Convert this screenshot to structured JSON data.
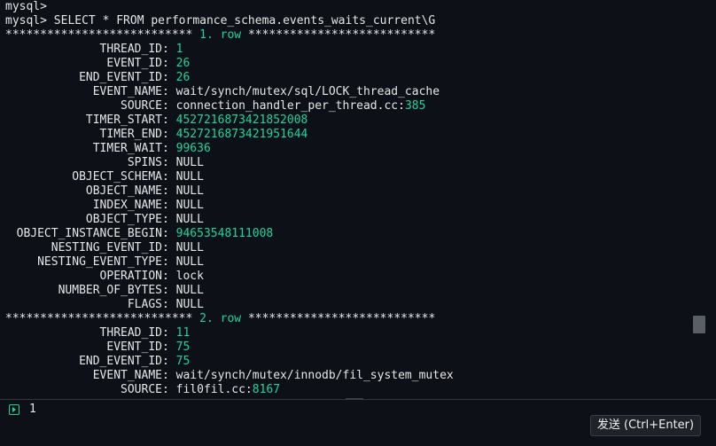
{
  "terminal": {
    "lines": [
      {
        "type": "text",
        "text": "mysql>"
      },
      {
        "type": "text",
        "text": "mysql> SELECT * FROM performance_schema.events_waits_current\\G"
      },
      {
        "type": "sep",
        "stars_left": "***************************",
        "row": "1. row",
        "stars_right": "***************************"
      },
      {
        "type": "kv",
        "key": "THREAD_ID",
        "value": "1",
        "num": true
      },
      {
        "type": "kv",
        "key": "EVENT_ID",
        "value": "26",
        "num": true
      },
      {
        "type": "kv",
        "key": "END_EVENT_ID",
        "value": "26",
        "num": true
      },
      {
        "type": "kv",
        "key": "EVENT_NAME",
        "value": "wait/synch/mutex/sql/LOCK_thread_cache",
        "num": false
      },
      {
        "type": "kvsrc",
        "key": "SOURCE",
        "value": "connection_handler_per_thread.cc:",
        "line": "385"
      },
      {
        "type": "kv",
        "key": "TIMER_START",
        "value": "4527216873421852008",
        "num": true
      },
      {
        "type": "kv",
        "key": "TIMER_END",
        "value": "4527216873421951644",
        "num": true
      },
      {
        "type": "kv",
        "key": "TIMER_WAIT",
        "value": "99636",
        "num": true
      },
      {
        "type": "kv",
        "key": "SPINS",
        "value": "NULL",
        "num": false
      },
      {
        "type": "kv",
        "key": "OBJECT_SCHEMA",
        "value": "NULL",
        "num": false
      },
      {
        "type": "kv",
        "key": "OBJECT_NAME",
        "value": "NULL",
        "num": false
      },
      {
        "type": "kv",
        "key": "INDEX_NAME",
        "value": "NULL",
        "num": false
      },
      {
        "type": "kv",
        "key": "OBJECT_TYPE",
        "value": "NULL",
        "num": false
      },
      {
        "type": "kv",
        "key": "OBJECT_INSTANCE_BEGIN",
        "value": "94653548111008",
        "num": true
      },
      {
        "type": "kv",
        "key": "NESTING_EVENT_ID",
        "value": "NULL",
        "num": false
      },
      {
        "type": "kv",
        "key": "NESTING_EVENT_TYPE",
        "value": "NULL",
        "num": false
      },
      {
        "type": "kv",
        "key": "OPERATION",
        "value": "lock",
        "num": false
      },
      {
        "type": "kv",
        "key": "NUMBER_OF_BYTES",
        "value": "NULL",
        "num": false
      },
      {
        "type": "kv",
        "key": "FLAGS",
        "value": "NULL",
        "num": false
      },
      {
        "type": "sep",
        "stars_left": "***************************",
        "row": "2. row",
        "stars_right": "***************************"
      },
      {
        "type": "kv",
        "key": "THREAD_ID",
        "value": "11",
        "num": true
      },
      {
        "type": "kv",
        "key": "EVENT_ID",
        "value": "75",
        "num": true
      },
      {
        "type": "kv",
        "key": "END_EVENT_ID",
        "value": "75",
        "num": true
      },
      {
        "type": "kv",
        "key": "EVENT_NAME",
        "value": "wait/synch/mutex/innodb/fil_system_mutex",
        "num": false
      },
      {
        "type": "kvsrc",
        "key": "SOURCE",
        "value": "fil0fil.cc:",
        "line": "8167"
      }
    ]
  },
  "input": {
    "line_number": "1"
  },
  "send_button": {
    "label": "发送 (Ctrl+Enter)"
  },
  "colors": {
    "background": "#0d1117",
    "text": "#e6e6e6",
    "accent": "#19d6a0"
  }
}
